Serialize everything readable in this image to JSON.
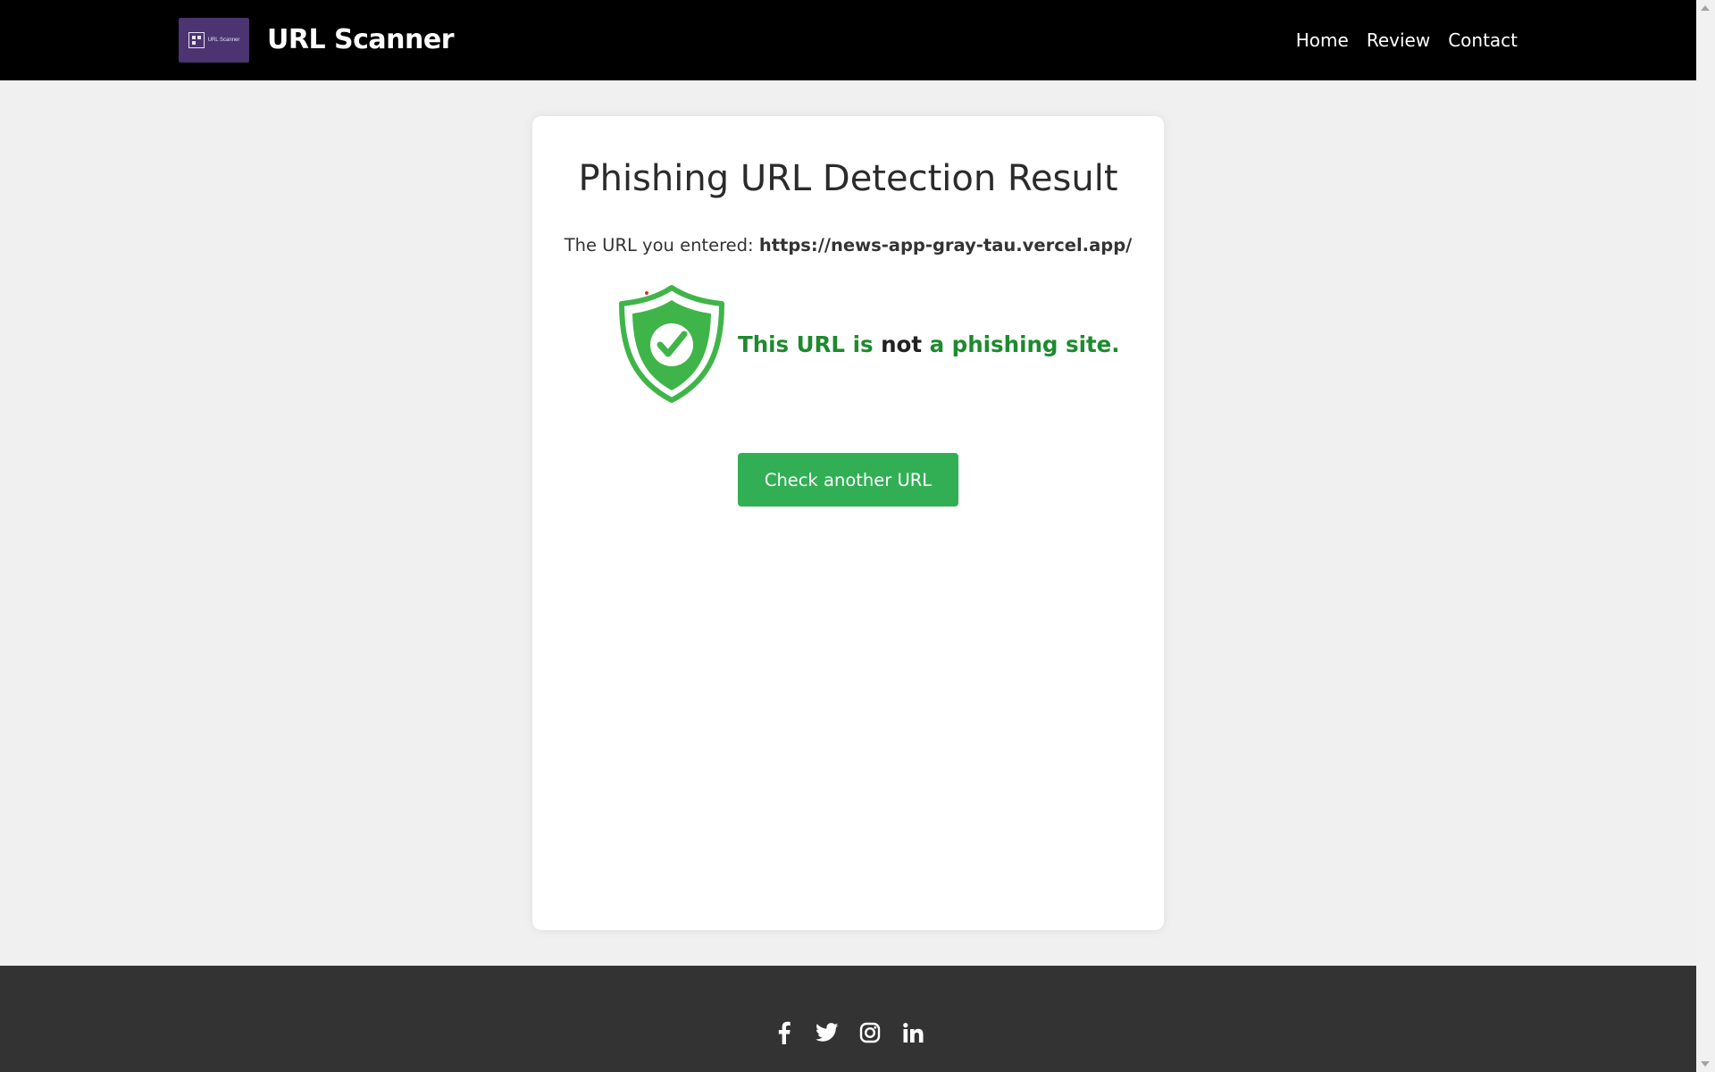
{
  "navbar": {
    "logo_text": "URL Scanner",
    "brand": "URL Scanner",
    "links": [
      "Home",
      "Review",
      "Contact"
    ]
  },
  "result": {
    "title": "Phishing URL Detection Result",
    "entered_label": "The URL you entered:",
    "entered_url": "https://news-app-gray-tau.vercel.app/",
    "message_part1": "This URL is",
    "message_part2": "not",
    "message_part3": "a phishing site.",
    "button_label": "Check another URL"
  },
  "footer": {
    "social_icons": [
      "facebook-icon",
      "twitter-icon",
      "instagram-icon",
      "linkedin-icon"
    ]
  },
  "colors": {
    "navbar_bg": "#000000",
    "accent_green": "#32af55",
    "safe_text_green": "#1d8a2e",
    "footer_bg": "#333333",
    "logo_bg": "#4b3470"
  }
}
